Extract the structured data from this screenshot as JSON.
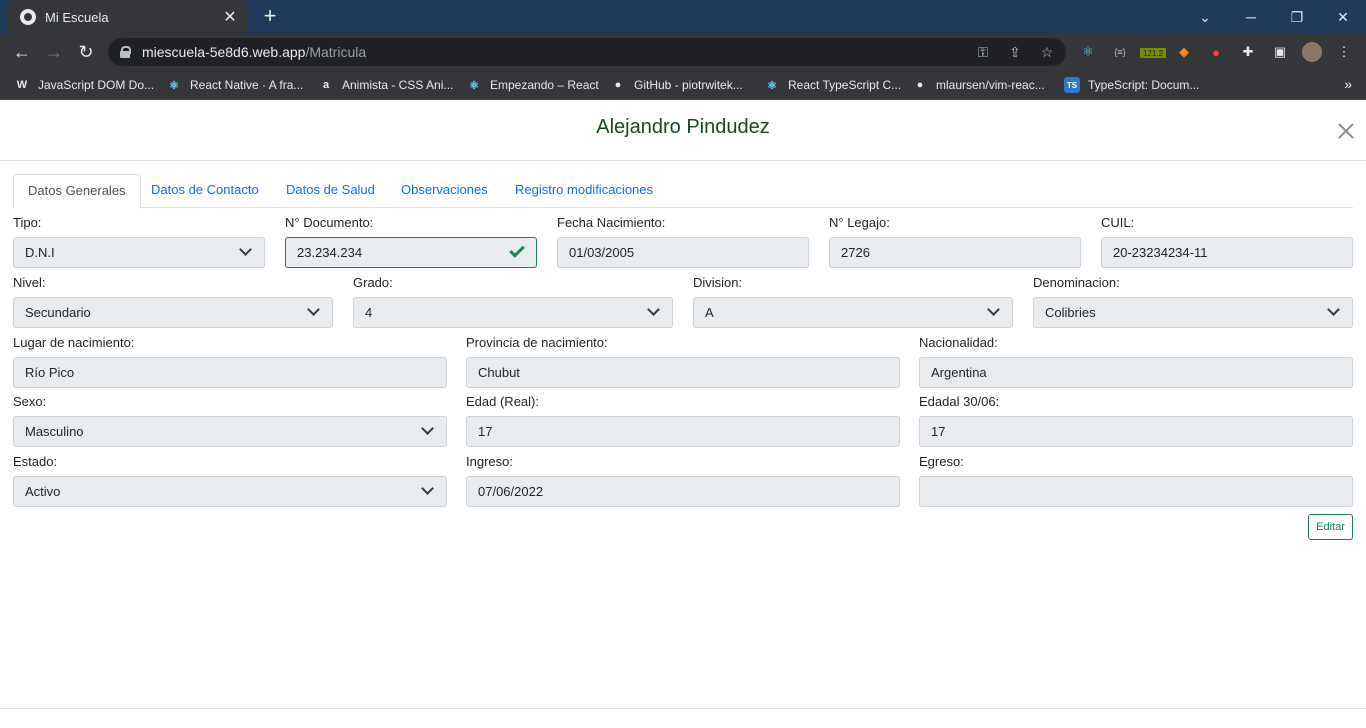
{
  "browser": {
    "tab_title": "Mi Escuela",
    "tab_close": "✕",
    "new_tab": "+",
    "url_host": "miescuela-5e8d6.web.app",
    "url_path": "/Matricula",
    "bookmarks": [
      {
        "label": "JavaScript DOM Do...",
        "icon": "W",
        "color": "#e8eaed"
      },
      {
        "label": "React Native · A fra...",
        "icon": "⚛",
        "color": "#61dafb"
      },
      {
        "label": "Animista - CSS Ani...",
        "icon": "a",
        "color": "#e8eaed"
      },
      {
        "label": "Empezando – React",
        "icon": "⚛",
        "color": "#61dafb"
      },
      {
        "label": "GitHub - piotrwitek...",
        "icon": "●",
        "color": "#e8eaed"
      },
      {
        "label": "React TypeScript C...",
        "icon": "⚛",
        "color": "#61dafb"
      },
      {
        "label": "mlaursen/vim-reac...",
        "icon": "●",
        "color": "#e8eaed"
      },
      {
        "label": "TypeScript: Docum...",
        "icon": "TS",
        "color": "#3178c6"
      }
    ],
    "extension_badge": "121.2"
  },
  "modal": {
    "title": "Alejandro Pindudez",
    "tabs": [
      {
        "label": "Datos Generales",
        "active": true
      },
      {
        "label": "Datos de Contacto",
        "active": false
      },
      {
        "label": "Datos de Salud",
        "active": false
      },
      {
        "label": "Observaciones",
        "active": false
      },
      {
        "label": "Registro modificaciones",
        "active": false
      }
    ],
    "fields": {
      "tipo": {
        "label": "Tipo:",
        "value": "D.N.I",
        "kind": "select"
      },
      "documento": {
        "label": "N° Documento:",
        "value": "23.234.234",
        "kind": "valid-input"
      },
      "fecha_nacimiento": {
        "label": "Fecha Nacimiento:",
        "value": "01/03/2005",
        "kind": "input"
      },
      "legajo": {
        "label": "N° Legajo:",
        "value": "2726",
        "kind": "input"
      },
      "cuil": {
        "label": "CUIL:",
        "value": "20-23234234-11",
        "kind": "input"
      },
      "nivel": {
        "label": "Nivel:",
        "value": "Secundario",
        "kind": "select"
      },
      "grado": {
        "label": "Grado:",
        "value": "4",
        "kind": "select"
      },
      "division": {
        "label": "Division:",
        "value": "A",
        "kind": "select"
      },
      "denominacion": {
        "label": "Denominacion:",
        "value": "Colibries",
        "kind": "select"
      },
      "lugar_nacimiento": {
        "label": "Lugar de nacimiento:",
        "value": "Río Pico",
        "kind": "input"
      },
      "provincia_nacimiento": {
        "label": "Provincia de nacimiento:",
        "value": "Chubut",
        "kind": "input"
      },
      "nacionalidad": {
        "label": "Nacionalidad:",
        "value": "Argentina",
        "kind": "input"
      },
      "sexo": {
        "label": "Sexo:",
        "value": "Masculino",
        "kind": "select"
      },
      "edad_real": {
        "label": "Edad (Real):",
        "value": "17",
        "kind": "input"
      },
      "edad_3006": {
        "label": "Edadal 30/06:",
        "value": "17",
        "kind": "input"
      },
      "estado": {
        "label": "Estado:",
        "value": "Activo",
        "kind": "select"
      },
      "ingreso": {
        "label": "Ingreso:",
        "value": "07/06/2022",
        "kind": "input"
      },
      "egreso": {
        "label": "Egreso:",
        "value": "",
        "kind": "input"
      }
    },
    "edit_button": "Editar"
  },
  "colors": {
    "title_green": "#1e4620",
    "tab_blue": "#0d6efd",
    "valid_green": "#198754",
    "field_bg": "#e9ecef"
  }
}
